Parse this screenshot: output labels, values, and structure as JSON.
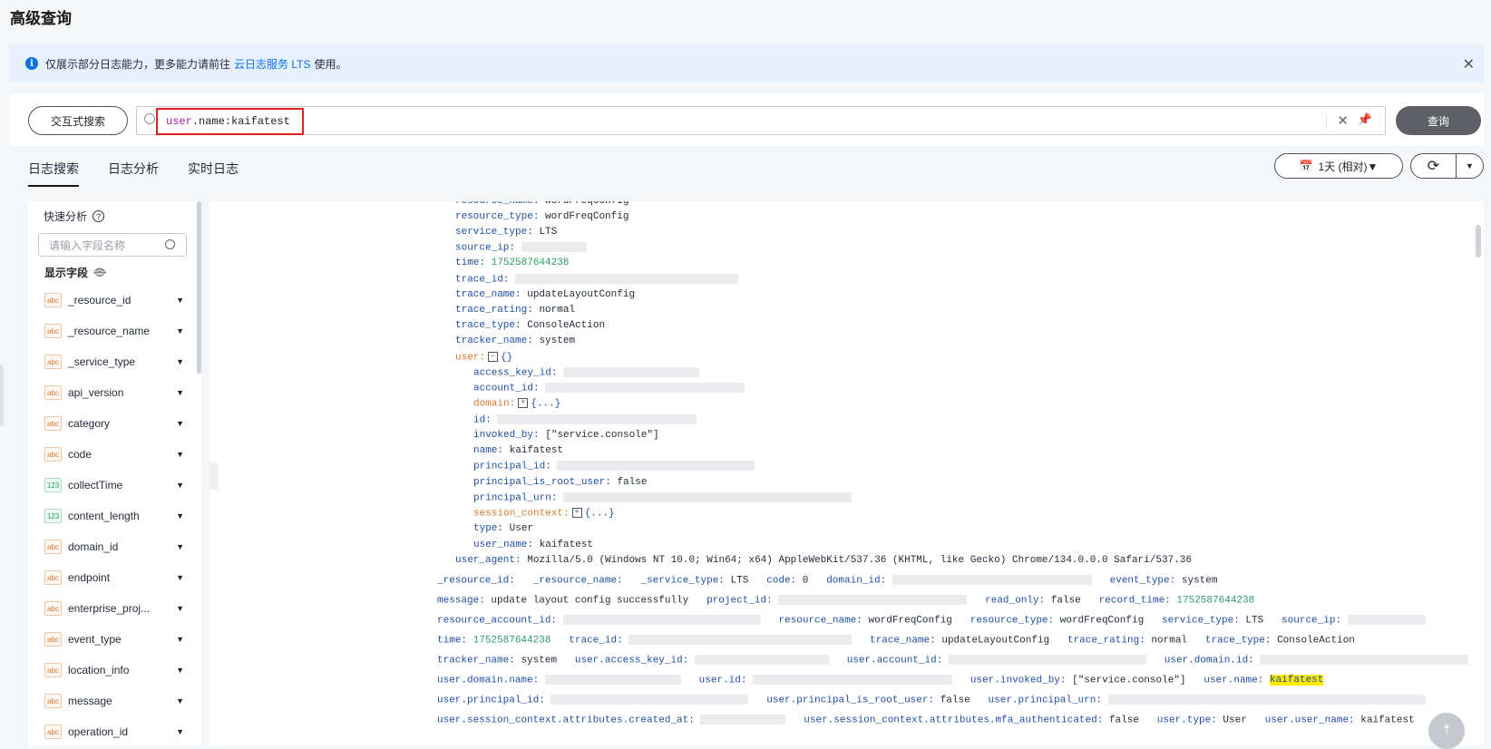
{
  "page": {
    "title": "高级查询"
  },
  "notice": {
    "text_before": "仅展示部分日志能力，更多能力请前往",
    "link": "云日志服务 LTS",
    "text_after": "使用。"
  },
  "search": {
    "mode_button": "交互式搜索",
    "query_key": "user",
    "query_rest": ".name:kaifatest",
    "submit": "查询"
  },
  "tabs": [
    {
      "label": "日志搜索"
    },
    {
      "label": "日志分析"
    },
    {
      "label": "实时日志"
    }
  ],
  "time_range": {
    "label": "1天 (相对)▼"
  },
  "sidebar": {
    "quick_title": "快速分析",
    "search_placeholder": "请输入字段名称",
    "shown_fields": "显示字段",
    "fields": [
      {
        "type": "abc",
        "name": "_resource_id"
      },
      {
        "type": "abc",
        "name": "_resource_name"
      },
      {
        "type": "abc",
        "name": "_service_type"
      },
      {
        "type": "abc",
        "name": "api_version"
      },
      {
        "type": "abc",
        "name": "category"
      },
      {
        "type": "abc",
        "name": "code"
      },
      {
        "type": "123",
        "name": "collectTime"
      },
      {
        "type": "123",
        "name": "content_length"
      },
      {
        "type": "abc",
        "name": "domain_id"
      },
      {
        "type": "abc",
        "name": "endpoint"
      },
      {
        "type": "abc",
        "name": "enterprise_proj..."
      },
      {
        "type": "abc",
        "name": "event_type"
      },
      {
        "type": "abc",
        "name": "location_info"
      },
      {
        "type": "abc",
        "name": "message"
      },
      {
        "type": "abc",
        "name": "operation_id"
      }
    ]
  },
  "log": {
    "resource_name": "wordFreqConfig",
    "resource_type": "wordFreqConfig",
    "service_type": "LTS",
    "time": "1752587644238",
    "trace_name": "updateLayoutConfig",
    "trace_rating": "normal",
    "trace_type": "ConsoleAction",
    "tracker_name": "system",
    "user_collapsed": "{}",
    "domain_collapsed": "{...}",
    "invoked_by": "[\"service.console\"]",
    "name": "kaifatest",
    "principal_is_root_user": "false",
    "session_context_collapsed": "{...}",
    "type": "User",
    "user_name": "kaifatest",
    "user_agent": "Mozilla/5.0 (Windows NT 10.0; Win64; x64) AppleWebKit/537.36 (KHTML, like Gecko) Chrome/134.0.0.0 Safari/537.36",
    "code": "0",
    "event_type": "system",
    "message": "update layout config successfully",
    "read_only": "false",
    "record_time": "1752587644238"
  }
}
